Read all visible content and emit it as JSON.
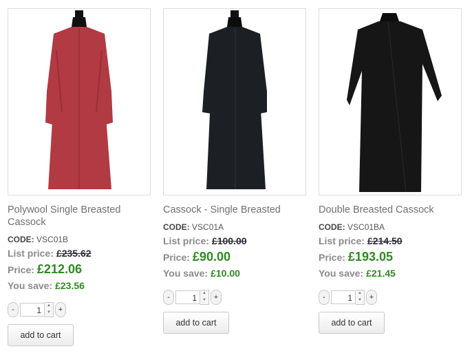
{
  "products": [
    {
      "title": "Polywool Single Breasted Cassock",
      "code_label": "CODE:",
      "code": "VSC01B",
      "list_label": "List price:",
      "list_price": "£235.62",
      "price_label": "Price:",
      "price": "£212.06",
      "save_label": "You save:",
      "save": "£23.56",
      "qty": "1",
      "minus": "-",
      "plus": "+",
      "cart": "add to cart",
      "garment_color": "#b23a42"
    },
    {
      "title": "Cassock - Single Breasted",
      "code_label": "CODE:",
      "code": "VSC01A",
      "list_label": "List price:",
      "list_price": "£100.00",
      "price_label": "Price:",
      "price": "£90.00",
      "save_label": "You save:",
      "save": "£10.00",
      "qty": "1",
      "minus": "-",
      "plus": "+",
      "cart": "add to cart",
      "garment_color": "#1c2024"
    },
    {
      "title": "Double Breasted Cassock",
      "code_label": "CODE:",
      "code": "VSC01BA",
      "list_label": "List price:",
      "list_price": "£214.50",
      "price_label": "Price:",
      "price": "£193.05",
      "save_label": "You save:",
      "save": "£21.45",
      "qty": "1",
      "minus": "-",
      "plus": "+",
      "cart": "add to cart",
      "garment_color": "#161616"
    }
  ]
}
